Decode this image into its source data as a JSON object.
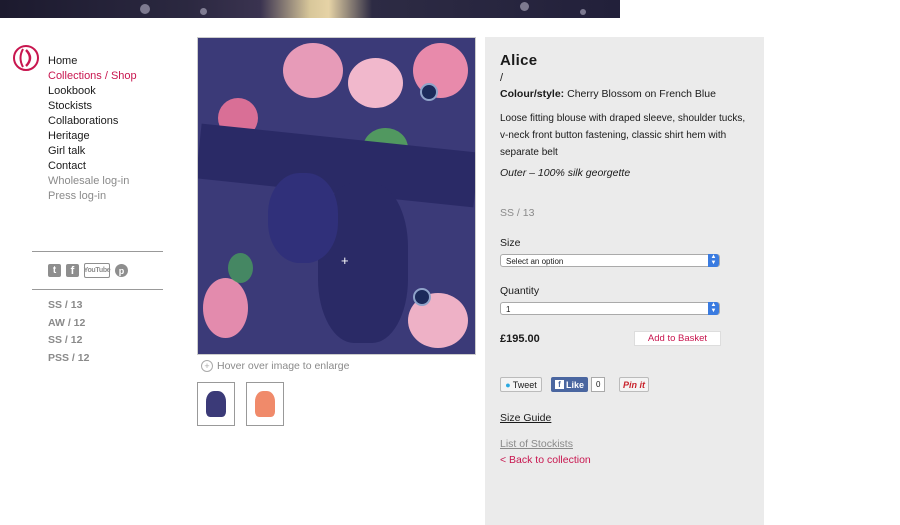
{
  "nav": {
    "items": [
      {
        "label": "Home",
        "state": "normal"
      },
      {
        "label": "Collections / Shop",
        "state": "active"
      },
      {
        "label": "Lookbook",
        "state": "normal"
      },
      {
        "label": "Stockists",
        "state": "normal"
      },
      {
        "label": "Collaborations",
        "state": "normal"
      },
      {
        "label": "Heritage",
        "state": "normal"
      },
      {
        "label": "Girl talk",
        "state": "normal"
      },
      {
        "label": "Contact",
        "state": "normal"
      },
      {
        "label": "Wholesale log-in",
        "state": "muted"
      },
      {
        "label": "Press log-in",
        "state": "muted"
      }
    ]
  },
  "social": {
    "twitter": "t",
    "facebook": "f",
    "youtube": "YouTube",
    "pinterest": "p"
  },
  "seasons": [
    "SS / 13",
    "AW / 12",
    "SS / 12",
    "PSS / 12"
  ],
  "gallery": {
    "hint": "Hover over image to enlarge"
  },
  "product": {
    "name": "Alice",
    "slash": "/",
    "colour_label": "Colour/style:",
    "colour_value": "Cherry Blossom on French Blue",
    "description": "Loose fitting blouse with draped sleeve, shoulder tucks, v-neck front button fastening, classic shirt hem with separate belt",
    "fabric": "Outer – 100% silk georgette",
    "season": "SS / 13",
    "size_label": "Size",
    "size_value": "Select an option",
    "quantity_label": "Quantity",
    "quantity_value": "1",
    "price": "£195.00",
    "basket_label": "Add to Basket",
    "tweet_label": "Tweet",
    "like_label": "Like",
    "like_count": "0",
    "pin_label": "Pin it",
    "size_guide": "Size Guide",
    "stockists_link": "List of Stockists",
    "back_link": "< Back to collection"
  },
  "colors": {
    "accent": "#c8164f",
    "panel_bg": "#ebebeb",
    "muted": "#8a8a8a",
    "fabric_blue": "#3b3a78"
  }
}
